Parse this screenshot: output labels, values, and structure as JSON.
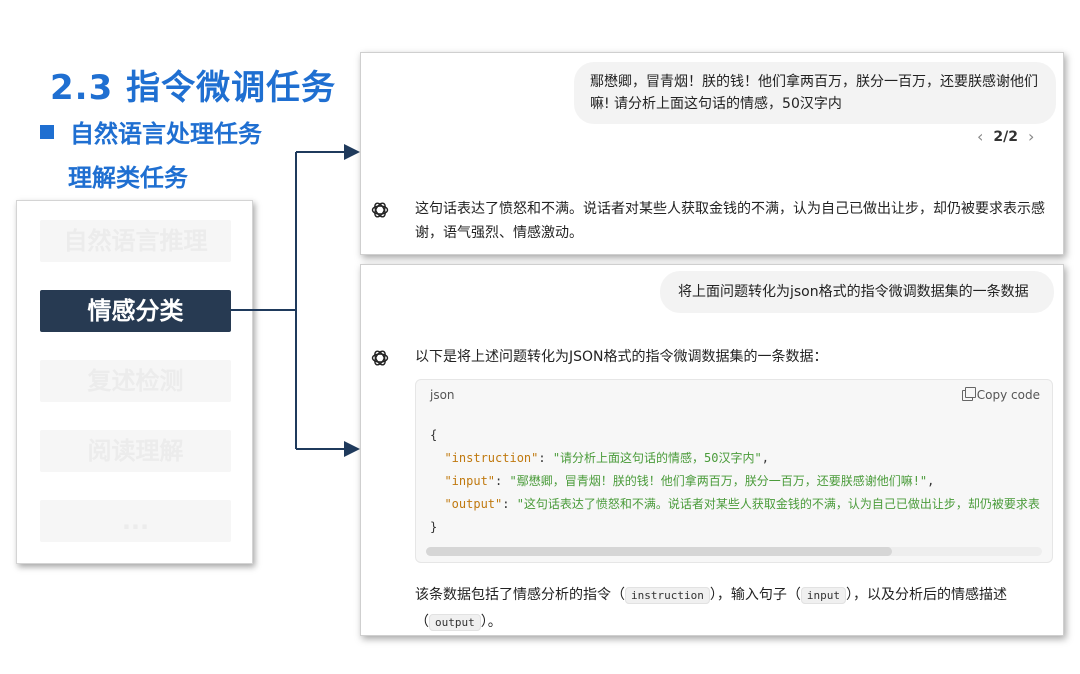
{
  "slide": {
    "title": "2.3 指令微调任务",
    "subtitle1": "自然语言处理任务",
    "subtitle2": "理解类任务",
    "tasks": [
      {
        "label": "自然语言推理",
        "active": false
      },
      {
        "label": "情感分类",
        "active": true
      },
      {
        "label": "复述检测",
        "active": false
      },
      {
        "label": "阅读理解",
        "active": false
      },
      {
        "label": "...",
        "active": false
      }
    ]
  },
  "chat1": {
    "user_message": "鄢懋卿，冒青烟！朕的钱！他们拿两百万，朕分一百万，还要朕感谢他们嘛! 请分析上面这句话的情感，50汉字内",
    "pager": {
      "prev": "‹",
      "text": "2/2",
      "next": "›"
    },
    "assistant_message": "这句话表达了愤怒和不满。说话者对某些人获取金钱的不满，认为自己已做出让步，却仍被要求表示感谢，语气强烈、情感激动。"
  },
  "chat2": {
    "user_message": "将上面问题转化为json格式的指令微调数据集的一条数据",
    "assistant_intro": "以下是将上述问题转化为JSON格式的指令微调数据集的一条数据：",
    "code": {
      "lang": "json",
      "copy_label": "Copy code",
      "open_brace": "{",
      "lines": [
        {
          "key": "\"instruction\"",
          "sep": ": ",
          "value": "\"请分析上面这句话的情感，50汉字内\"",
          "end": ","
        },
        {
          "key": "\"input\"",
          "sep": ": ",
          "value": "\"鄢懋卿，冒青烟！朕的钱！他们拿两百万，朕分一百万，还要朕感谢他们嘛!\"",
          "end": ","
        },
        {
          "key": "\"output\"",
          "sep": ": ",
          "value": "\"这句话表达了愤怒和不满。说话者对某些人获取金钱的不满，认为自己已做出让步，却仍被要求表",
          "end": ""
        }
      ],
      "close_brace": "}",
      "scroll_position": 0.76
    },
    "footer": {
      "part1": "该条数据包括了情感分析的指令（",
      "code1": "instruction",
      "part2": "），输入句子（",
      "code2": "input",
      "part3": "），以及分析后的情感描述（",
      "code3": "output",
      "part4": "）。"
    }
  },
  "colors": {
    "title_blue": "#1f6fd1",
    "active_task_bg": "#273a52",
    "connector": "#1f3a5c",
    "json_key": "#c0790f",
    "json_string": "#4a9b3a"
  }
}
